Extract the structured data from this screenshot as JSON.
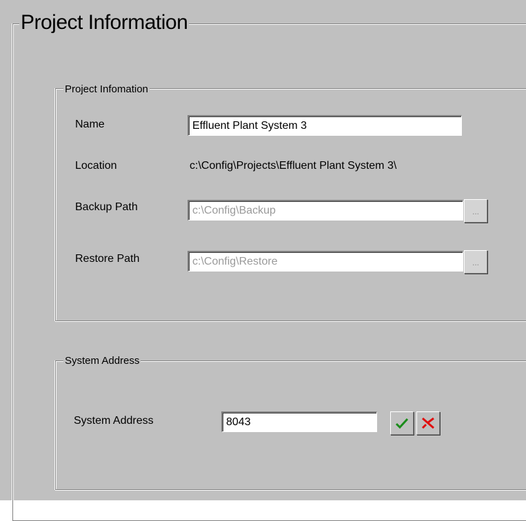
{
  "panel": {
    "title": "Project Information"
  },
  "project_info": {
    "group_title": "Project Infomation",
    "name_label": "Name",
    "name_value": "Effluent Plant System 3",
    "location_label": "Location",
    "location_value": "c:\\Config\\Projects\\Effluent Plant System 3\\",
    "backup_label": "Backup Path",
    "backup_value": "c:\\Config\\Backup",
    "backup_browse_label": "...",
    "restore_label": "Restore Path",
    "restore_value": "c:\\Config\\Restore",
    "restore_browse_label": "..."
  },
  "system_address": {
    "group_title": "System Address",
    "label": "System Address",
    "value": "8043",
    "accept_icon": "check-icon",
    "cancel_icon": "x-icon"
  },
  "colors": {
    "background": "#c0c0c0",
    "accept": "#1a8c1a",
    "cancel": "#e01010"
  }
}
